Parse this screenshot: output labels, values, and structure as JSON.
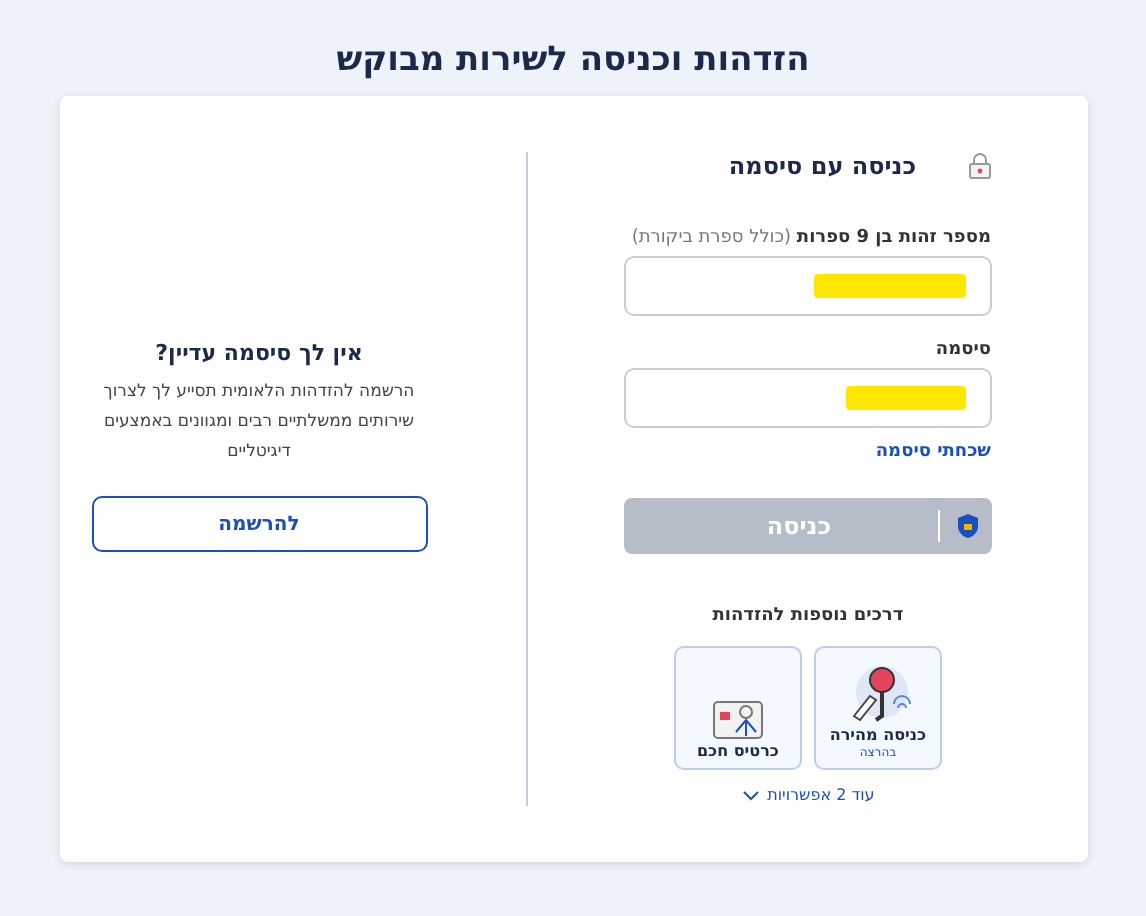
{
  "page_title": "הזדהות וכניסה לשירות מבוקש",
  "login": {
    "title": "כניסה עם סיסמה",
    "id_field": {
      "label": "מספר זהות בן 9 ספרות",
      "hint": "(כולל ספרת ביקורת)",
      "redacted": true
    },
    "password_field": {
      "label": "סיסמה",
      "redacted": true
    },
    "forgot_link": "שכחתי סיסמה",
    "submit": {
      "label": "כניסה",
      "disabled": true
    },
    "other_methods_title": "דרכים נוספות להזדהות",
    "methods": [
      {
        "kind": "keys",
        "label": "כניסה מהירה",
        "sublabel": "בהרצה"
      },
      {
        "kind": "card",
        "label": "כרטיס חכם"
      }
    ],
    "more_options": "עוד 2 אפשרויות"
  },
  "register": {
    "title": "אין לך סיסמה עדיין?",
    "text": "הרשמה להזדהות הלאומית תסייע לך לצרוך שירותים ממשלתיים רבים ומגוונים באמצעים דיגיטליים",
    "button": "להרשמה"
  }
}
